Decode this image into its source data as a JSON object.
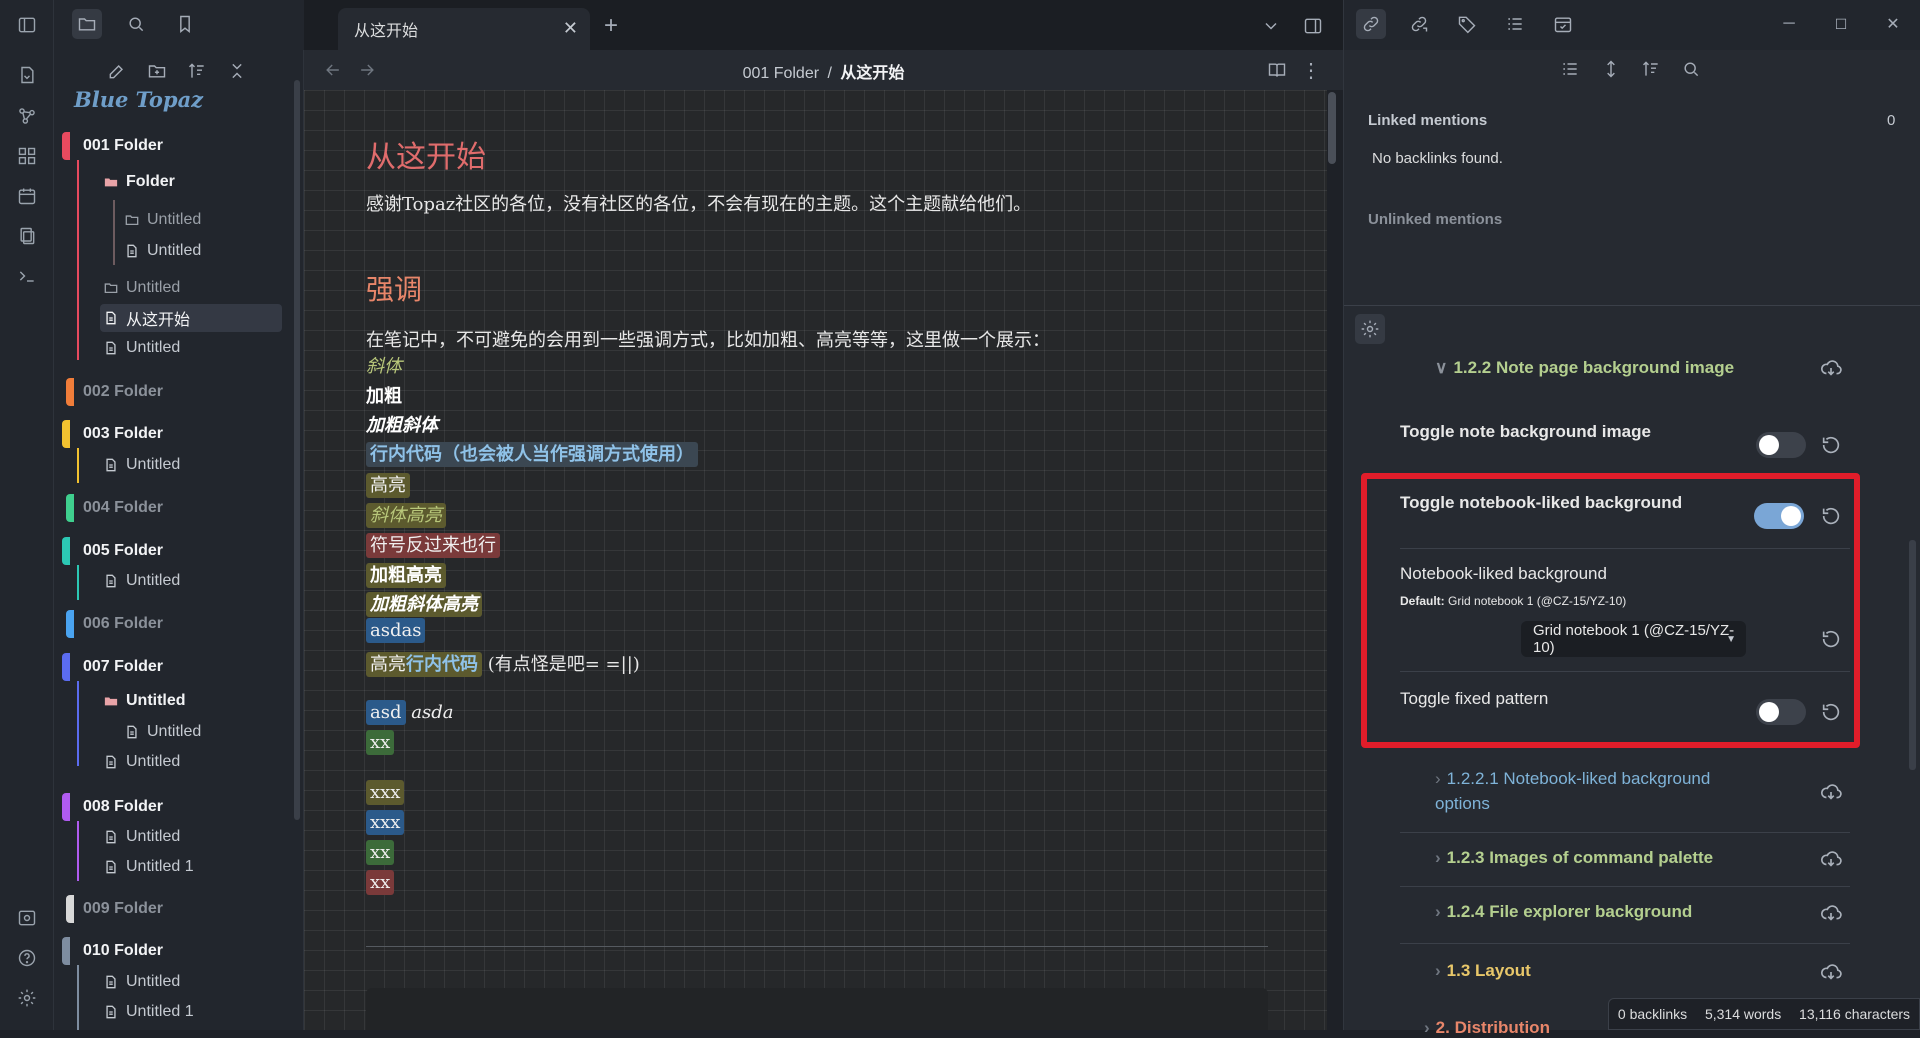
{
  "sidebar": {
    "logo": "Blue Topaz",
    "items": [
      {
        "label": "001 Folder"
      },
      {
        "label": "Folder"
      },
      {
        "label": "Untitled"
      },
      {
        "label": "Untitled"
      },
      {
        "label": "Untitled"
      },
      {
        "label": "从这开始"
      },
      {
        "label": "Untitled"
      },
      {
        "label": "002 Folder"
      },
      {
        "label": "003 Folder"
      },
      {
        "label": "Untitled"
      },
      {
        "label": "004 Folder"
      },
      {
        "label": "005 Folder"
      },
      {
        "label": "Untitled"
      },
      {
        "label": "006 Folder"
      },
      {
        "label": "007 Folder"
      },
      {
        "label": "Untitled"
      },
      {
        "label": "Untitled"
      },
      {
        "label": "Untitled"
      },
      {
        "label": "008 Folder"
      },
      {
        "label": "Untitled"
      },
      {
        "label": "Untitled 1"
      },
      {
        "label": "009 Folder"
      },
      {
        "label": "010 Folder"
      },
      {
        "label": "Untitled"
      },
      {
        "label": "Untitled 1"
      }
    ],
    "folder_colors": [
      "#e84a5f",
      "#f07d3a",
      "#f2c230",
      "#3fcf8e",
      "#2cc8b4",
      "#4aa3f0",
      "#5b6cf0",
      "#b05bf0",
      "#d8d8d8",
      "#7e8da0"
    ]
  },
  "tabs": {
    "active": "从这开始"
  },
  "view_header": {
    "path": "001 Folder",
    "separator": "/",
    "title": "从这开始"
  },
  "editor": {
    "h1": "从这开始",
    "p1": "感谢Topaz社区的各位，没有社区的各位，不会有现在的主题。这个主题献给他们。",
    "h2": "强调",
    "p2": "在笔记中，不可避免的会用到一些强调方式，比如加粗、高亮等等，这里做一个展示：",
    "italic": "斜体",
    "bold": "加粗",
    "bold_italic": "加粗斜体",
    "inline_code": "行内代码（也会被人当作强调方式使用）",
    "highlight": "高亮",
    "italic_highlight": "斜体高亮",
    "reverse": "符号反过来也行",
    "bold_highlight": "加粗高亮",
    "bold_italic_highlight": "加粗斜体高亮",
    "asdas": "asdas",
    "mix_a": "高亮",
    "mix_b": "行内代码",
    "mix_c": "(有点怪是吧= =||)",
    "asd": "asd",
    "asda": "asda",
    "xx1": "xx",
    "xxx1": "xxx",
    "xxx2": "xxx",
    "xx2": "xx",
    "xx3": "xx"
  },
  "backlinks": {
    "linked": "Linked mentions",
    "linked_count": "0",
    "none": "No backlinks found.",
    "unlinked": "Unlinked mentions"
  },
  "settings": {
    "sect_122": "1.2.2 Note page background image",
    "toggle_note_bg": "Toggle note background image",
    "toggle_notebook": "Toggle notebook-liked background",
    "notebook_bg": "Notebook-liked background",
    "default_label": "Default:",
    "default_value": "Grid notebook 1 (@CZ-15/YZ-10)",
    "dropdown_value": "Grid notebook 1 (@CZ-15/YZ-10)",
    "toggle_fixed": "Toggle fixed pattern",
    "sect_1221a": "1.2.2.1 Notebook-liked background",
    "sect_1221b": "options",
    "sect_123": "1.2.3 Images of command palette",
    "sect_124": "1.2.4 File explorer background",
    "sect_13": "1.3 Layout",
    "sect_next": "2. Distribution"
  },
  "status": {
    "backlinks": "0 backlinks",
    "words": "5,314 words",
    "chars": "13,116 characters"
  },
  "colors": {
    "accent": "#7aa6d6",
    "highlight_box": "#e11d2a",
    "toggle_on": "#7aa6d6"
  }
}
